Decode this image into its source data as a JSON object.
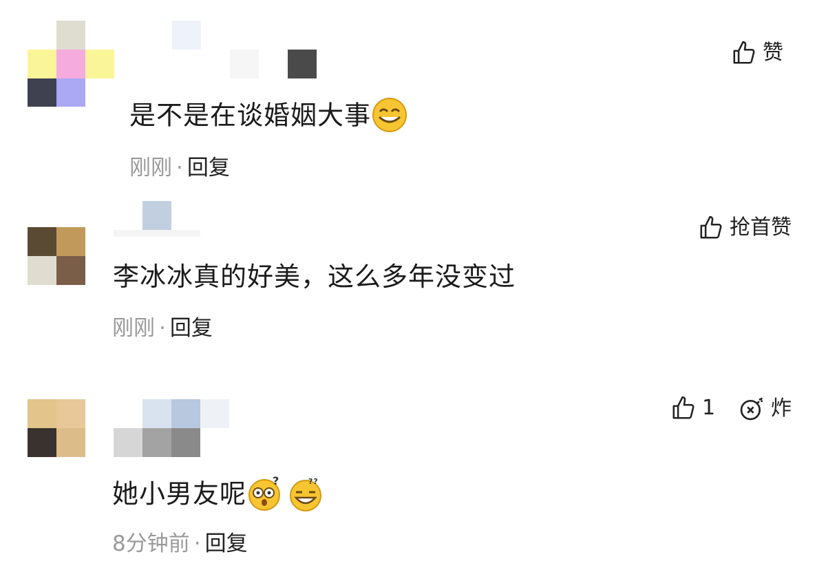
{
  "comments": [
    {
      "text": "是不是在谈婚姻大事",
      "time": "刚刚",
      "separator": "·",
      "reply_label": "回复",
      "like_label": "赞",
      "emojis": [
        "grinning-squint-emoji"
      ]
    },
    {
      "text": "李冰冰真的好美，这么多年没变过",
      "time": "刚刚",
      "separator": "·",
      "reply_label": "回复",
      "like_label": "抢首赞"
    },
    {
      "text": "她小男友呢",
      "time": "8分钟前",
      "separator": "·",
      "reply_label": "回复",
      "like_count": "1",
      "bomb_label": "炸",
      "emojis": [
        "confused-question-emoji",
        "dizzy-grin-emoji"
      ]
    }
  ],
  "colors": {
    "text": "#1b1b1b",
    "muted": "#9a9a9a",
    "emoji_yellow": "#f7c531"
  }
}
